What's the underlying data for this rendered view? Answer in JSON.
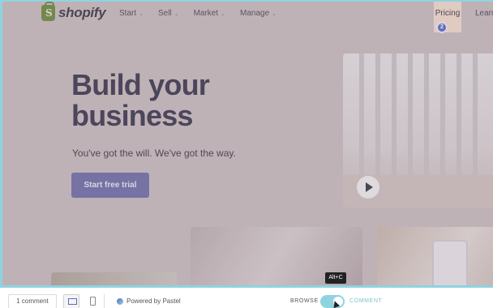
{
  "site": {
    "logo_letter": "S",
    "logo_text": "shopify",
    "menu": [
      {
        "label": "Start"
      },
      {
        "label": "Sell"
      },
      {
        "label": "Market"
      },
      {
        "label": "Manage"
      }
    ],
    "pricing": "Pricing",
    "learn": "Learn",
    "comment_pin": "2",
    "hero_title": "Build your business",
    "hero_subtitle": "You've got the will. We've got the way.",
    "cta_label": "Start free trial"
  },
  "toolbar": {
    "comments_count": "1 comment",
    "powered_by": "Powered by Pastel",
    "browse_label": "BROWSE",
    "comment_label": "COMMENT",
    "shortcut_tooltip": "Alt+C",
    "mode": "comment"
  },
  "colors": {
    "accent": "#8fd3e0",
    "pin": "#5b6cc0",
    "cta": "#6f6fa8"
  }
}
